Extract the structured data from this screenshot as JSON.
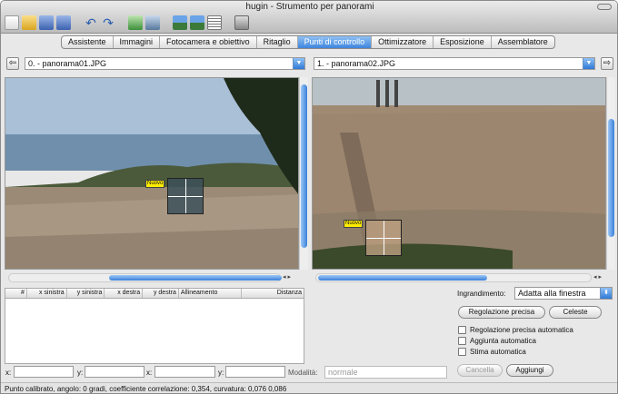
{
  "window": {
    "title": "hugin - Strumento per panorami"
  },
  "toolbar": {
    "icons": [
      "new-file-icon",
      "open-file-icon",
      "save-icon",
      "save-as-icon",
      "undo-icon",
      "redo-icon",
      "add-image-icon",
      "add-series-icon",
      "preview-icon",
      "fast-preview-icon",
      "layout-icon",
      "batch-icon"
    ]
  },
  "tabs": [
    "Assistente",
    "Immagini",
    "Fotocamera e obiettivo",
    "Ritaglio",
    "Punti di controllo",
    "Ottimizzatore",
    "Esposizione",
    "Assemblatore"
  ],
  "left": {
    "image": "0. - panorama01.JPG",
    "cp_label": "Nuovo"
  },
  "right": {
    "image": "1. - panorama02.JPG",
    "cp_label": "Nuovo"
  },
  "table": {
    "columns": [
      "#",
      "x sinistra",
      "y sinistra",
      "x destra",
      "y destra",
      "Allineamento",
      "Distanza"
    ]
  },
  "zoom": {
    "label": "Ingrandimento:",
    "value": "Adatta alla finestra"
  },
  "buttons": {
    "fine_tune": "Regolazione precisa",
    "celeste": "Celeste",
    "cancel": "Cancella",
    "add": "Aggiungi"
  },
  "checks": [
    "Regolazione precisa automatica",
    "Aggiunta automatica",
    "Stima automatica"
  ],
  "coords": {
    "x1": "x:",
    "y1": "y:",
    "x2": "x:",
    "y2": "y:",
    "mode_label": "Modalità:",
    "mode_value": "normale"
  },
  "status": "Punto calibrato, angolo: 0 gradi, coefficiente correlazione: 0,354, curvatura: 0,076 0,086"
}
